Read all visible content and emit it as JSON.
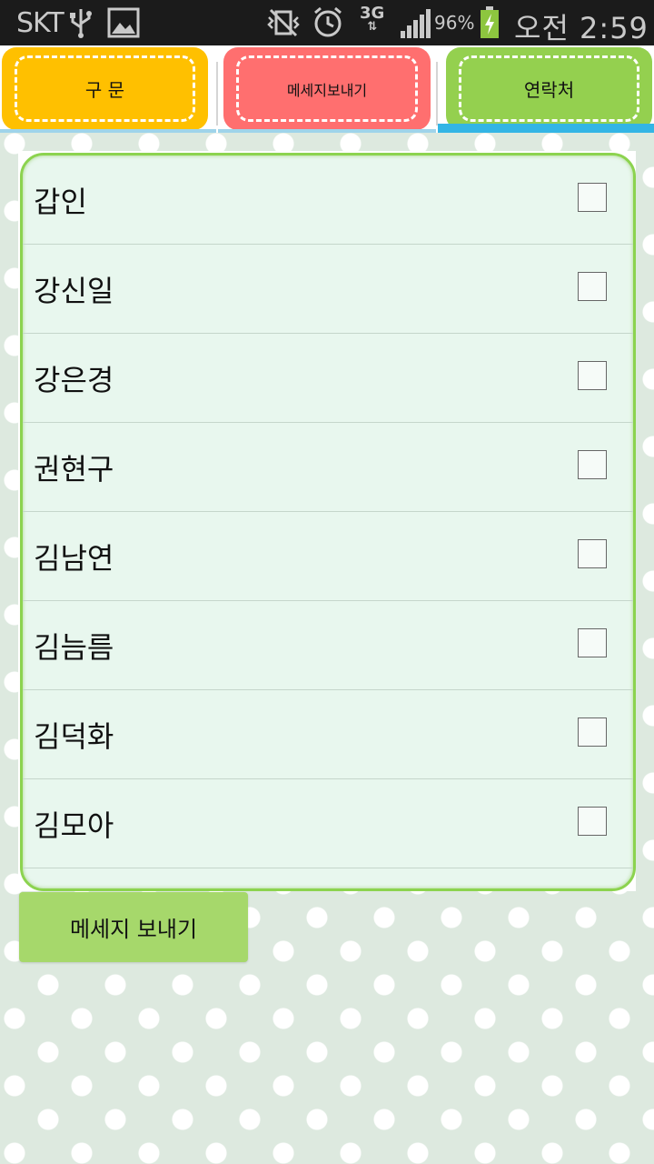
{
  "status_bar": {
    "carrier": "SKT",
    "network": "3G",
    "battery_percent": "96%",
    "time": "오전 2:59",
    "icons": [
      "usb-icon",
      "image-icon",
      "vibrate-icon",
      "alarm-icon",
      "signal-icon",
      "battery-charging-icon"
    ]
  },
  "tabs": [
    {
      "label": "구 문",
      "color": "#ffc000"
    },
    {
      "label": "메세지보내기",
      "color": "#ff6f6f"
    },
    {
      "label": "연락처",
      "color": "#94d04f",
      "selected": true
    }
  ],
  "contacts": [
    {
      "name": "갑인",
      "checked": false
    },
    {
      "name": "강신일",
      "checked": false
    },
    {
      "name": "강은경",
      "checked": false
    },
    {
      "name": "권현구",
      "checked": false
    },
    {
      "name": "김남연",
      "checked": false
    },
    {
      "name": "김늠름",
      "checked": false
    },
    {
      "name": "김덕화",
      "checked": false
    },
    {
      "name": "김모아",
      "checked": false
    }
  ],
  "send_button": {
    "label": "메세지 보내기",
    "color": "#a6d86b"
  },
  "colors": {
    "accent": "#33b5e5",
    "list_border": "#8cd34f",
    "list_bg": "#e8f7ee"
  }
}
